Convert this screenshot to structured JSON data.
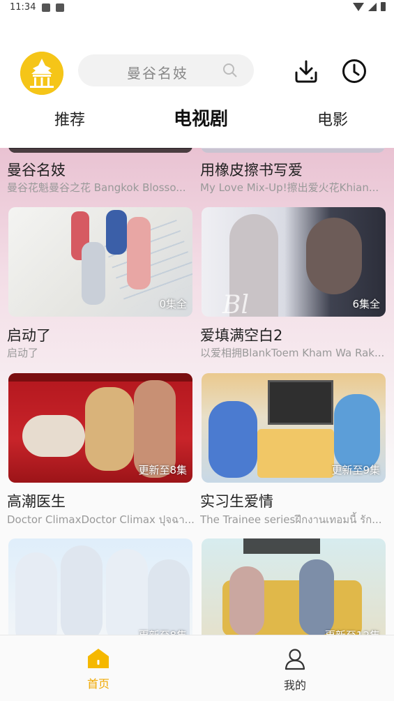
{
  "status": {
    "time": "11:34"
  },
  "header": {
    "search_placeholder": "曼谷名妓",
    "tabs": [
      {
        "label": "推荐",
        "active": false
      },
      {
        "label": "电视剧",
        "active": true
      },
      {
        "label": "电影",
        "active": false
      }
    ]
  },
  "items": [
    {
      "title": "曼谷名妓",
      "subtitle": "曼谷花魁曼谷之花 Bangkok Blosso...",
      "badge": ""
    },
    {
      "title": "用橡皮擦书写爱",
      "subtitle": "My Love Mix-Up!擦出爱火花Khian...",
      "badge": ""
    },
    {
      "title": "启动了",
      "subtitle": "启动了",
      "badge": "0集全"
    },
    {
      "title": "爱填满空白2",
      "subtitle": "以爱相拥BlankToem Kham Wa Rak...",
      "badge": "6集全"
    },
    {
      "title": "高潮医生",
      "subtitle": "Doctor ClimaxDoctor Climax ปุจฉา...",
      "badge": "更新至8集"
    },
    {
      "title": "实习生爱情",
      "subtitle": "The Trainee seriesฝึกงานเทอมนี้ รัก...",
      "badge": "更新至9集"
    },
    {
      "title": "",
      "subtitle": "",
      "badge": "更新至8集"
    },
    {
      "title": "",
      "subtitle": "",
      "badge": "更新至12集"
    }
  ],
  "bottom_nav": [
    {
      "label": "首页",
      "active": true,
      "icon": "home-icon"
    },
    {
      "label": "我的",
      "active": false,
      "icon": "profile-icon"
    }
  ],
  "colors": {
    "accent": "#f5b800",
    "active_nav": "#f0a800",
    "inactive_nav": "#333333"
  }
}
